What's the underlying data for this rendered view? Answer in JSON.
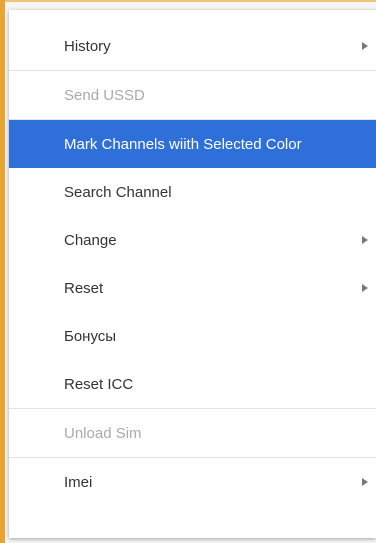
{
  "menu": {
    "items": [
      {
        "label": "History",
        "submenu": true,
        "disabled": false
      },
      {
        "label": "Send USSD",
        "submenu": false,
        "disabled": true
      },
      {
        "label": "Mark Channels wiith Selected Color",
        "submenu": false,
        "disabled": false,
        "highlighted": true
      },
      {
        "label": "Search Channel",
        "submenu": false,
        "disabled": false
      },
      {
        "label": "Change",
        "submenu": true,
        "disabled": false
      },
      {
        "label": "Reset",
        "submenu": true,
        "disabled": false
      },
      {
        "label": "Бонусы",
        "submenu": false,
        "disabled": false
      },
      {
        "label": "Reset ICC",
        "submenu": false,
        "disabled": false
      },
      {
        "label": "Unload Sim",
        "submenu": false,
        "disabled": true
      },
      {
        "label": "Imei",
        "submenu": true,
        "disabled": false
      }
    ]
  },
  "colors": {
    "highlight": "#2f6fd9",
    "window_edge": "#e9a433",
    "disabled_text": "#aaaaaa"
  }
}
